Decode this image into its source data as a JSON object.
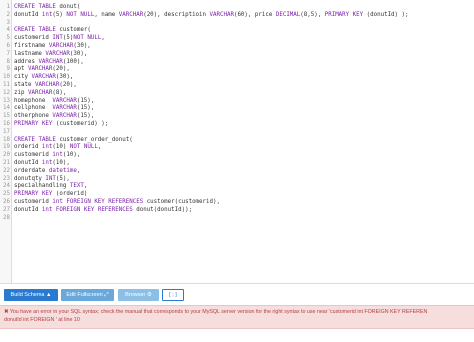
{
  "editor": {
    "lines": [
      {
        "n": "1",
        "t": "CREATE TABLE donut("
      },
      {
        "n": "2",
        "t": "donutId int(5) NOT NULL, name VARCHAR(20), descriptioin VARCHAR(60), price DECIMAL(8,5), PRIMARY KEY (donutId) );"
      },
      {
        "n": "3",
        "t": ""
      },
      {
        "n": "4",
        "t": "CREATE TABLE customer("
      },
      {
        "n": "5",
        "t": "customerid INT(5)NOT NULL,"
      },
      {
        "n": "6",
        "t": "firstname VARCHAR(30),"
      },
      {
        "n": "7",
        "t": "lastname VARCHAR(30),"
      },
      {
        "n": "8",
        "t": "addres VARCHAR(100),"
      },
      {
        "n": "9",
        "t": "apt VARCHAR(20),"
      },
      {
        "n": "10",
        "t": "city VARCHAR(30),"
      },
      {
        "n": "11",
        "t": "state VARCHAR(20),"
      },
      {
        "n": "12",
        "t": "zip VARCHAR(8),"
      },
      {
        "n": "13",
        "t": "homephone  VARCHAR(15),"
      },
      {
        "n": "14",
        "t": "cellphone  VARCHAR(15),"
      },
      {
        "n": "15",
        "t": "otherphone VARCHAR(15),"
      },
      {
        "n": "16",
        "t": "PRIMARY KEY (customerid) );"
      },
      {
        "n": "17",
        "t": ""
      },
      {
        "n": "18",
        "t": "CREATE TABLE customer_order_donut("
      },
      {
        "n": "19",
        "t": "orderid int(10) NOT NULL,"
      },
      {
        "n": "20",
        "t": "customerid int(10),"
      },
      {
        "n": "21",
        "t": "donutId int(10),"
      },
      {
        "n": "22",
        "t": "orderdate datetime,"
      },
      {
        "n": "23",
        "t": "donutqty INT(5),"
      },
      {
        "n": "24",
        "t": "specialhandling TEXT,"
      },
      {
        "n": "25",
        "t": "PRIMARY KEY (orderid)"
      },
      {
        "n": "26",
        "t": "customerid int FOREIGN KEY REFERENCES customer(customerid),"
      },
      {
        "n": "27",
        "t": "donutId int FOREIGN KEY REFERENCES donut(donutId));"
      },
      {
        "n": "28",
        "t": ""
      }
    ]
  },
  "toolbar": {
    "build_schema": "Build Schema ▲",
    "edit_fullscreen": "Edit Fullscreen ⤢",
    "browser": "Browser ⚙",
    "delimiter": "[ ; ]"
  },
  "error": {
    "line1": "✖ You have an error in your SQL syntax; check the manual that corresponds to your MySQL server version for the right syntax to use near 'customerid int FOREIGN KEY REFEREN",
    "line2": "donutId int FOREIGN ' at line 10"
  }
}
